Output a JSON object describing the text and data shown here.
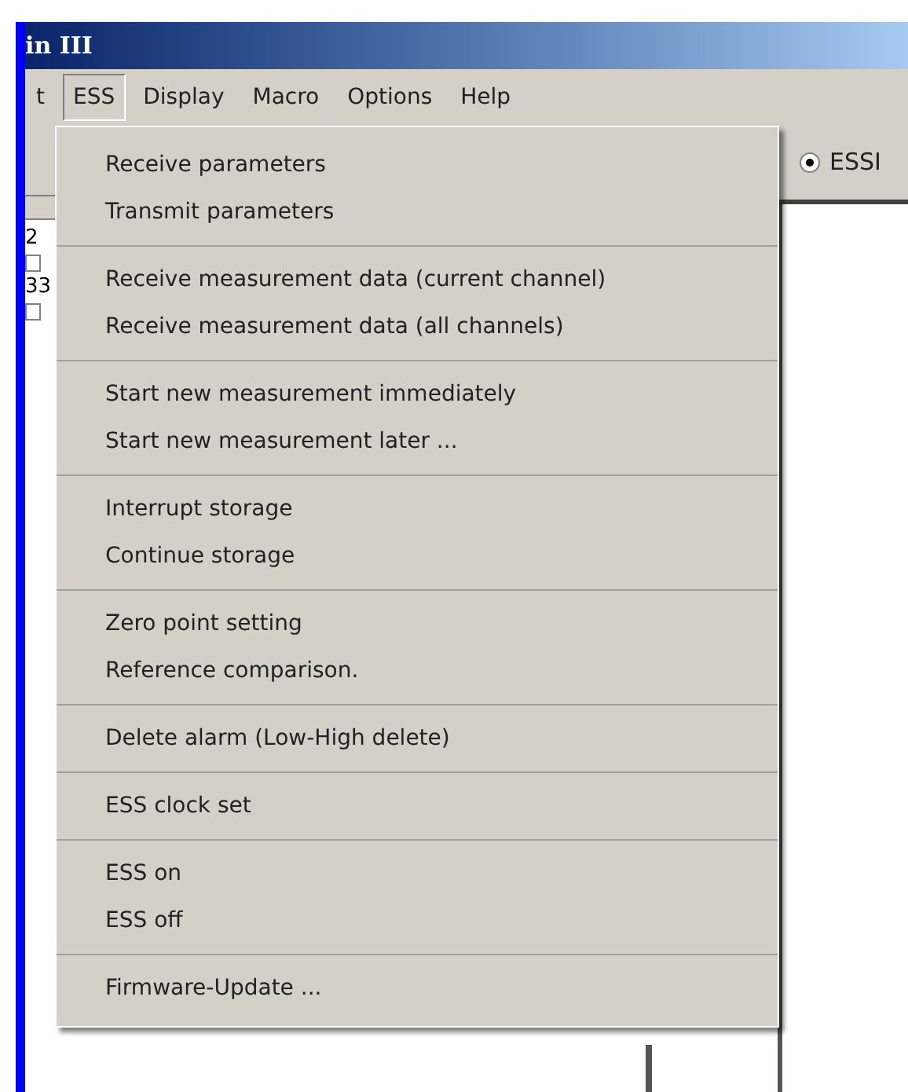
{
  "window": {
    "title": "in III"
  },
  "menubar": [
    {
      "label": "t",
      "selected": false
    },
    {
      "label": "ESS",
      "selected": true
    },
    {
      "label": "Display",
      "selected": false
    },
    {
      "label": "Macro",
      "selected": false
    },
    {
      "label": "Options",
      "selected": false
    },
    {
      "label": "Help",
      "selected": false
    }
  ],
  "menu": {
    "groups": [
      [
        "Receive parameters",
        "Transmit parameters"
      ],
      [
        "Receive measurement data (current channel)",
        "Receive measurement data (all channels)"
      ],
      [
        "Start new measurement immediately",
        "Start new measurement later ..."
      ],
      [
        "Interrupt storage",
        "Continue storage"
      ],
      [
        "Zero point setting",
        "Reference comparison."
      ],
      [
        "Delete alarm (Low-High delete)"
      ],
      [
        "ESS clock set"
      ],
      [
        "ESS on",
        "ESS off"
      ],
      [
        "Firmware-Update ..."
      ]
    ]
  },
  "left_list": [
    {
      "label": "2",
      "checked": false
    },
    {
      "label": "33",
      "checked": false
    }
  ],
  "right_panel": {
    "radio": {
      "label": "ESSI",
      "selected": true
    }
  }
}
